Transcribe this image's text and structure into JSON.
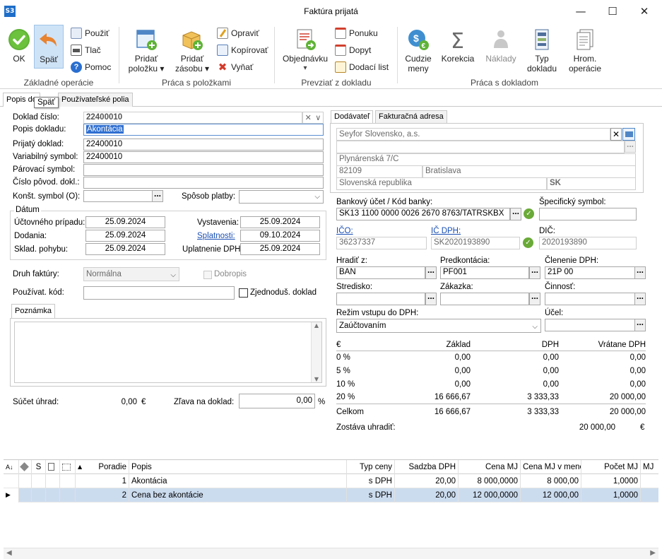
{
  "window": {
    "app_logo": "S3",
    "title": "Faktúra prijatá",
    "min_glyph": "—",
    "max_glyph": "☐",
    "close_glyph": "✕"
  },
  "ribbon": {
    "groups": [
      {
        "title": "Základné operácie"
      },
      {
        "title": "Práca s položkami"
      },
      {
        "title": "Prevziať z dokladu"
      },
      {
        "title": "Práca s dokladom"
      }
    ],
    "ok": "OK",
    "back": "Späť",
    "apply": "Použiť",
    "print": "Tlač",
    "help": "Pomoc",
    "add_item_1": "Pridať",
    "add_item_2": "položku ▾",
    "add_stock_1": "Pridať",
    "add_stock_2": "zásobu ▾",
    "edit": "Opraviť",
    "copy": "Kopírovať",
    "cut": "Vyňať",
    "order_1": "Objednávku",
    "order_2": "▾",
    "offer": "Ponuku",
    "request": "Dopyt",
    "delivery_note": "Dodací list",
    "foreign_1": "Cudzie",
    "foreign_2": "meny",
    "correction": "Korekcia",
    "costs": "Náklady",
    "doc_type_1": "Typ",
    "doc_type_2": "dokladu",
    "bulk_1": "Hrom.",
    "bulk_2": "operácie"
  },
  "tabs": {
    "description": "Popis do",
    "user_fields": "Používateľské polia",
    "tooltip": "Späť"
  },
  "form": {
    "doc_number_label": "Doklad číslo:",
    "doc_number": "22400010",
    "doc_desc_label": "Popis dokladu:",
    "doc_desc": "Akontácia",
    "received_label": "Prijatý doklad:",
    "received": "22400010",
    "var_symbol_label": "Variabilný symbol:",
    "var_symbol": "22400010",
    "pairing_label": "Párovací symbol:",
    "pairing": "",
    "orig_doc_label": "Číslo pôvod. dokl.:",
    "orig_doc": "",
    "const_symbol_label": "Konšt. symbol (O):",
    "const_symbol": "",
    "payment_label": "Spôsob platby:",
    "payment": "",
    "dates_title": "Dátum",
    "accounting_label": "Účtovného prípadu:",
    "accounting": "25.09.2024",
    "delivery_label": "Dodania:",
    "delivery": "25.09.2024",
    "stock_label": "Sklad. pohybu:",
    "stock": "25.09.2024",
    "issue_label": "Vystavenia:",
    "issue": "25.09.2024",
    "due_label": "Splatnosti:",
    "due": "09.10.2024",
    "vat_apply_label": "Uplatnenie DPH:",
    "vat_apply": "25.09.2024",
    "invoice_type_label": "Druh faktúry:",
    "invoice_type": "Normálna",
    "credit_note_label": "Dobropis",
    "user_code_label": "Používat. kód:",
    "user_code": "",
    "simplified_label": "Zjednoduš. doklad",
    "note_tab": "Poznámka",
    "payments_sum_label": "Súčet úhrad:",
    "payments_sum": "0,00",
    "payments_cur": "€",
    "discount_label": "Zľava na doklad:",
    "discount": "0,00",
    "discount_unit": "%"
  },
  "supplier": {
    "tab_supplier": "Dodávateľ",
    "tab_invoice_addr": "Fakturačná adresa",
    "name": "Seyfor Slovensko, a.s.",
    "street": "Plynárenská 7/C",
    "zip": "82109",
    "city": "Bratislava",
    "country": "Slovenská republika",
    "country_code": "SK",
    "bank_label": "Bankový účet / Kód banky:",
    "bank": "SK13 1100 0000 0026 2670 8763/TATRSKBX",
    "specific_label": "Špecifický symbol:",
    "specific": "",
    "ico_label": "IČO:",
    "ico": "36237337",
    "icdph_label": "IČ DPH:",
    "icdph": "SK2020193890",
    "dic_label": "DIČ:",
    "dic": "2020193890",
    "pay_by_label": "Hradiť z:",
    "pay_by": "BAN",
    "precont_label": "Predkontácia:",
    "precont": "PF001",
    "vat_split_label": "Členenie DPH:",
    "vat_split": "21P 00",
    "center_label": "Stredisko:",
    "center": "",
    "contract_label": "Zákazka:",
    "contract": "",
    "activity_label": "Činnosť:",
    "activity": "",
    "vat_mode_label": "Režim vstupu do DPH:",
    "vat_mode": "Zaúčtovaním",
    "purpose_label": "Účel:",
    "purpose": ""
  },
  "vat_table": {
    "headers": [
      "€",
      "Základ",
      "DPH",
      "Vrátane DPH"
    ],
    "rows": [
      [
        "0 %",
        "0,00",
        "0,00",
        "0,00"
      ],
      [
        "5 %",
        "0,00",
        "0,00",
        "0,00"
      ],
      [
        "10 %",
        "0,00",
        "0,00",
        "0,00"
      ],
      [
        "20 %",
        "16 666,67",
        "3 333,33",
        "20 000,00"
      ]
    ],
    "total": [
      "Celkom",
      "16 666,67",
      "3 333,33",
      "20 000,00"
    ],
    "remaining_label": "Zostáva uhradiť:",
    "remaining": "20 000,00",
    "remaining_cur": "€"
  },
  "grid": {
    "headers": {
      "s": "S",
      "order": "Poradie",
      "desc": "Popis",
      "price_type": "Typ ceny",
      "vat_rate": "Sadzba DPH",
      "unit_price": "Cena MJ",
      "unit_price_cur": "Cena MJ v mene",
      "qty": "Počet MJ",
      "mj": "MJ"
    },
    "rows": [
      {
        "order": "1",
        "desc": "Akontácia",
        "price_type": "s DPH",
        "vat_rate": "20,00",
        "unit_price": "8 000,0000",
        "unit_price_cur": "8 000,00",
        "qty": "1,0000"
      },
      {
        "order": "2",
        "desc": "Cena bez akontácie",
        "price_type": "s DPH",
        "vat_rate": "20,00",
        "unit_price": "12 000,0000",
        "unit_price_cur": "12 000,00",
        "qty": "1,0000"
      }
    ]
  }
}
